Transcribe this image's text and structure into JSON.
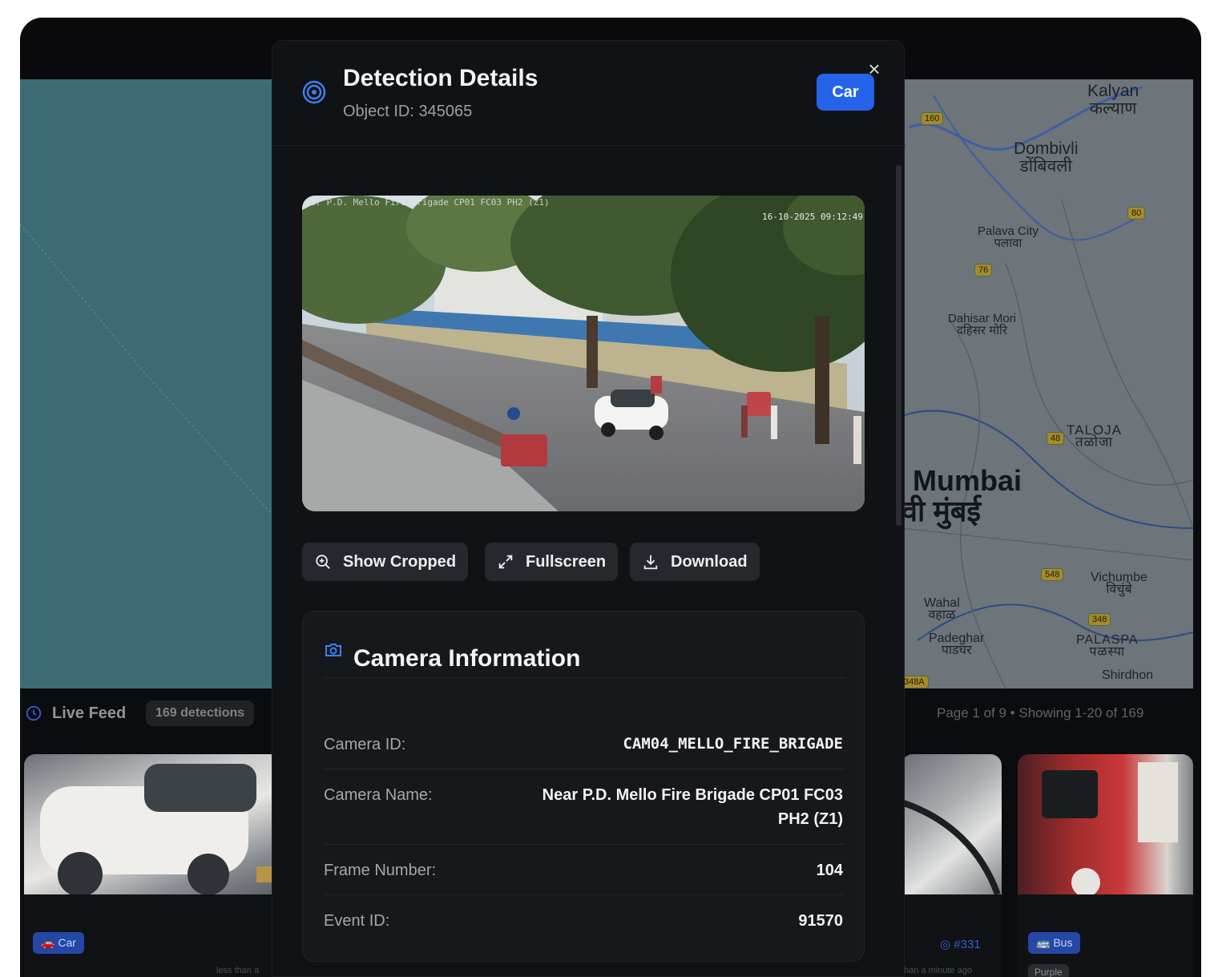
{
  "modal": {
    "title": "Detection Details",
    "object_id": "Object ID: 345065",
    "type_badge": "Car",
    "close_glyph": "×",
    "image_overlay": {
      "top_left": "ear P.D. Mello Fire Brigade CP01 FC03 PH2 (Z1)",
      "timestamp": "16-10-2025 09:12:49"
    },
    "actions": {
      "show_cropped": "Show Cropped",
      "fullscreen": "Fullscreen",
      "download": "Download"
    },
    "camera_info": {
      "title": "Camera Information",
      "rows": [
        {
          "label": "Camera ID:",
          "value": "CAM04_MELLO_FIRE_BRIGADE"
        },
        {
          "label": "Camera Name:",
          "value": "Near P.D. Mello Fire Brigade CP01 FC03 PH2 (Z1)"
        },
        {
          "label": "Frame Number:",
          "value": "104"
        },
        {
          "label": "Event ID:",
          "value": "91570"
        }
      ]
    }
  },
  "feed": {
    "title": "Live Feed",
    "badge": "169 detections",
    "page_info": "Page 1 of 9  •  Showing 1-20 of 169",
    "cards": [
      {
        "type": "Car",
        "time": "less than a"
      },
      {
        "id": "#331",
        "time": "than a minute ago"
      },
      {
        "type": "Bus",
        "color": "Purple"
      }
    ]
  },
  "map": {
    "places": [
      {
        "name": "Kalyan",
        "local": "कल्याण"
      },
      {
        "name": "Dombivli",
        "local": "डोंबिवली"
      },
      {
        "name": "Palava City",
        "local": "पलावा"
      },
      {
        "name": "Dahisar Mori",
        "local": "दहिसर मोरि"
      },
      {
        "name": "TALOJA",
        "local": "तळोजा"
      },
      {
        "name": "Mumbai",
        "local": "वी मुंबई"
      },
      {
        "name": "Vichumbe",
        "local": "विचुंबे"
      },
      {
        "name": "Wahal",
        "local": "वहाळ"
      },
      {
        "name": "Padeghar",
        "local": "पाडघर"
      },
      {
        "name": "PALASPA",
        "local": "पळस्पा"
      },
      {
        "name": "Shirdhon",
        "local": ""
      }
    ],
    "shields": [
      "160",
      "80",
      "76",
      "48",
      "548",
      "348",
      "348A"
    ]
  },
  "colors": {
    "accent": "#2563eb",
    "modal_bg": "#111215",
    "card_bg": "#17181b",
    "map_teal": "#3c6b75"
  },
  "icons": {
    "header": "target-icon",
    "close": "close-icon",
    "show_cropped": "zoom-in-icon",
    "fullscreen": "expand-icon",
    "download": "download-icon",
    "camera": "camera-icon",
    "feed": "clock-icon"
  }
}
